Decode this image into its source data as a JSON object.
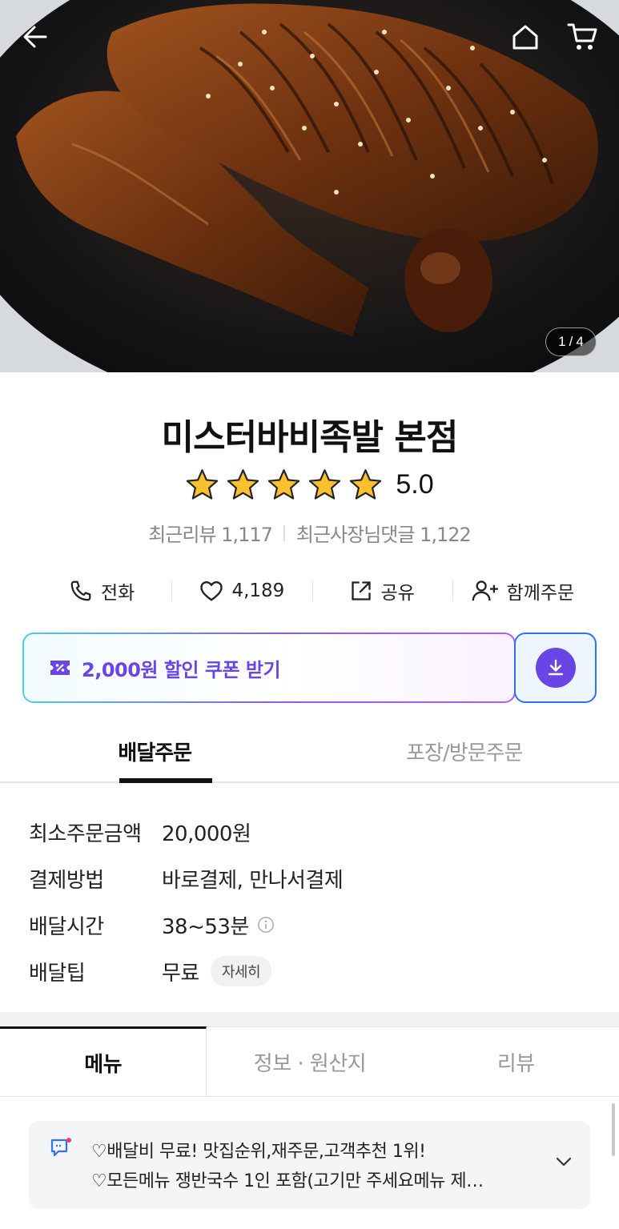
{
  "hero": {
    "page_current": "1",
    "page_sep": "/",
    "page_total": "4"
  },
  "store": {
    "name": "미스터바비족발 본점",
    "rating": "5.0",
    "star_count": 5,
    "recent_reviews": "최근리뷰 1,117",
    "owner_replies": "최근사장님댓글 1,122"
  },
  "actions": {
    "call": "전화",
    "likes": "4,189",
    "share": "공유",
    "group_order": "함께주문"
  },
  "coupon": {
    "label": "2,000원 할인 쿠폰 받기",
    "accent": "#6a45e6"
  },
  "order_tabs": {
    "delivery": "배달주문",
    "pickup": "포장/방문주문"
  },
  "info": {
    "min_order_label": "최소주문금액",
    "min_order_value": "20,000원",
    "payment_label": "결제방법",
    "payment_value": "바로결제, 만나서결제",
    "delivery_time_label": "배달시간",
    "delivery_time_value": "38~53분",
    "delivery_tip_label": "배달팁",
    "delivery_tip_value": "무료",
    "detail_chip": "자세히"
  },
  "content_tabs": {
    "menu": "메뉴",
    "info_origin": "정보 · 원산지",
    "review": "리뷰"
  },
  "notice": {
    "line1": "♡배달비 무료! 맛집순위,재주문,고객추천 1위!",
    "line2": "♡모든메뉴 쟁반국수 1인 포함(고기만 주세요메뉴 제…"
  }
}
